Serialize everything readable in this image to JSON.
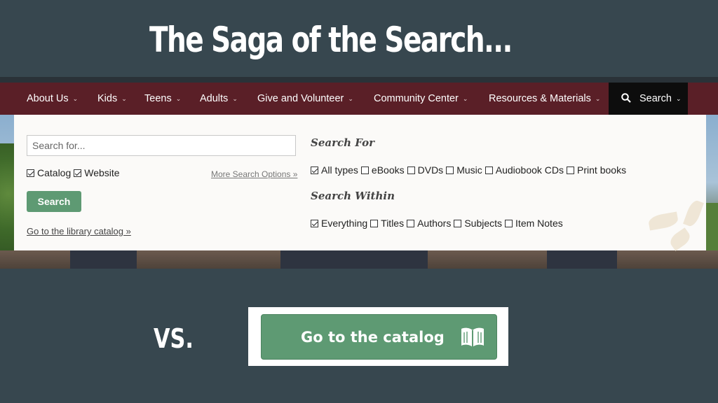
{
  "slide": {
    "title": "The Saga of the Search...",
    "vs_label": "VS."
  },
  "nav": {
    "items": [
      {
        "label": "About Us"
      },
      {
        "label": "Kids"
      },
      {
        "label": "Teens"
      },
      {
        "label": "Adults"
      },
      {
        "label": "Give and Volunteer"
      },
      {
        "label": "Community Center"
      },
      {
        "label": "Resources & Materials"
      }
    ],
    "search_label": "Search"
  },
  "search_panel": {
    "input_placeholder": "Search for...",
    "scope": [
      {
        "label": "Catalog",
        "checked": true
      },
      {
        "label": "Website",
        "checked": true
      }
    ],
    "more_options_link": "More Search Options »",
    "search_button": "Search",
    "catalog_link": "Go to the library catalog »",
    "search_for": {
      "heading": "Search For",
      "options": [
        {
          "label": "All types",
          "checked": true
        },
        {
          "label": "eBooks",
          "checked": false
        },
        {
          "label": "DVDs",
          "checked": false
        },
        {
          "label": "Music",
          "checked": false
        },
        {
          "label": "Audiobook CDs",
          "checked": false
        },
        {
          "label": "Print books",
          "checked": false
        }
      ]
    },
    "search_within": {
      "heading": "Search Within",
      "options": [
        {
          "label": "Everything",
          "checked": true
        },
        {
          "label": "Titles",
          "checked": false
        },
        {
          "label": "Authors",
          "checked": false
        },
        {
          "label": "Subjects",
          "checked": false
        },
        {
          "label": "Item Notes",
          "checked": false
        }
      ]
    }
  },
  "cta": {
    "label": "Go to the catalog",
    "icon": "open-book-icon"
  },
  "colors": {
    "slide_bg": "#37474f",
    "nav_bg": "#5a1f27",
    "nav_search_bg": "#0d0d0d",
    "accent_green": "#5e9a73"
  }
}
